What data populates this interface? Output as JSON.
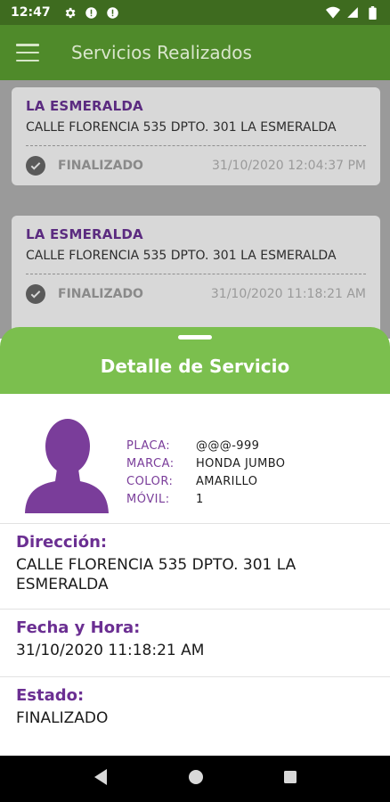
{
  "status_bar": {
    "time": "12:47",
    "left_icons": [
      "gear-icon",
      "alert-icon",
      "alert-icon"
    ],
    "right_icons": [
      "wifi-icon",
      "signal-icon",
      "battery-icon"
    ]
  },
  "app_bar": {
    "title": "Servicios Realizados"
  },
  "list": [
    {
      "title": "LA ESMERALDA",
      "address": "CALLE FLORENCIA 535 DPTO. 301 LA ESMERALDA",
      "status": "FINALIZADO",
      "datetime": "31/10/2020 12:04:37 PM"
    },
    {
      "title": "LA ESMERALDA",
      "address": "CALLE FLORENCIA 535 DPTO. 301 LA ESMERALDA",
      "status": "FINALIZADO",
      "datetime": "31/10/2020 11:18:21 AM"
    }
  ],
  "sheet": {
    "title": "Detalle de Servicio",
    "vehicle": [
      {
        "label": "PLACA:",
        "value": "@@@-999"
      },
      {
        "label": "MARCA:",
        "value": "HONDA JUMBO"
      },
      {
        "label": "COLOR:",
        "value": "AMARILLO"
      },
      {
        "label": "MÓVIL:",
        "value": "1"
      }
    ],
    "direccion_label": "Dirección:",
    "direccion_value": "CALLE FLORENCIA 535 DPTO. 301 LA ESMERALDA",
    "fecha_label": "Fecha y Hora:",
    "fecha_value": "31/10/2020 11:18:21 AM",
    "estado_label": "Estado:",
    "estado_value": "FINALIZADO"
  },
  "colors": {
    "status_bar": "#3e6b1f",
    "app_bar": "#4f8a2a",
    "sheet_header": "#7bbf4e",
    "accent_purple": "#6b2f92",
    "avatar": "#7a3d9a"
  },
  "nav_bar": {
    "icons": [
      "back-icon",
      "home-icon",
      "recents-icon"
    ]
  }
}
